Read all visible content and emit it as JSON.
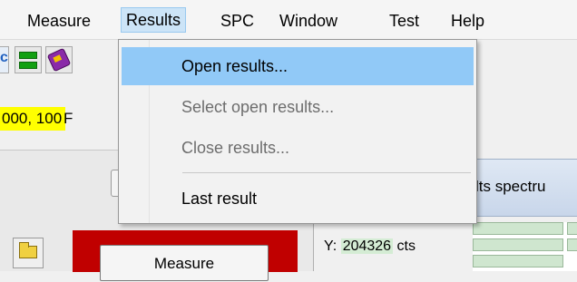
{
  "menubar": {
    "items": [
      {
        "label": "Measure"
      },
      {
        "label": "Results"
      },
      {
        "label": "SPC"
      },
      {
        "label": "Window"
      },
      {
        "label": "Test"
      },
      {
        "label": "Help"
      }
    ],
    "open_menu": "Results"
  },
  "results_menu": {
    "items": [
      {
        "label": "Open results...",
        "enabled": true,
        "highlighted": true
      },
      {
        "label": "Select open results...",
        "enabled": false
      },
      {
        "label": "Close results...",
        "enabled": false
      },
      {
        "label": "Last result",
        "enabled": true
      }
    ]
  },
  "toolbar": {
    "button1_glyph": "c",
    "icons": [
      "spectrum-icon",
      "bars-icon",
      "book-icon"
    ]
  },
  "coordinates": {
    "value": "000, 100",
    "trailing_letter": "F"
  },
  "spectrum_panel": {
    "title": "lts spectru",
    "y_label": "Y:",
    "y_value": "204326",
    "y_unit": "cts"
  },
  "measure_panel": {
    "measure_label": "Measure"
  },
  "colors": {
    "menu_highlight": "#91c9f7",
    "coords_bg": "#ffff00",
    "measure_frame": "#c00000"
  }
}
